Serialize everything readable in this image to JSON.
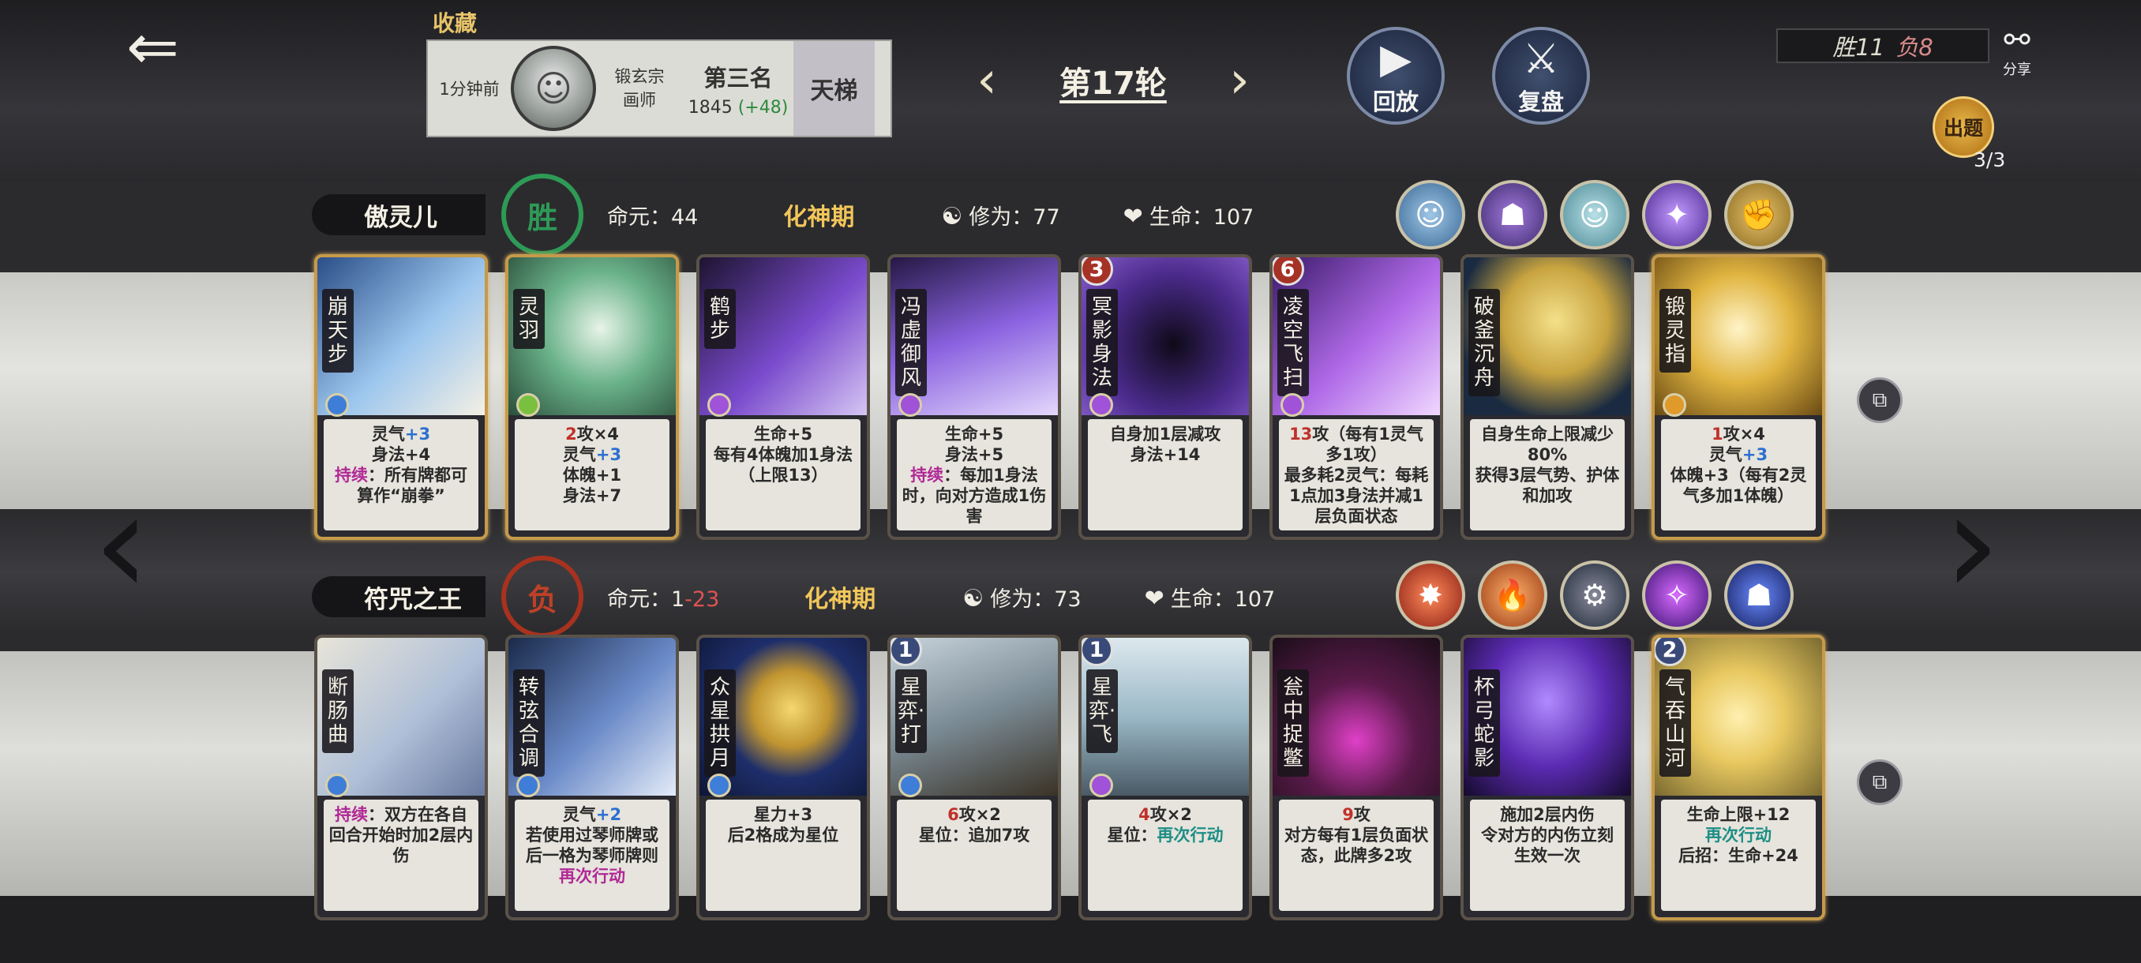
{
  "header": {
    "favorite_label": "收藏",
    "opponent": {
      "time_ago": "1分钟前",
      "sect_line1": "锻玄宗",
      "sect_line2": "画师",
      "rank_name": "第三名",
      "rank_score": "1845",
      "rank_delta": "(+48)",
      "ladder_label": "天梯"
    },
    "round_title": "第17轮",
    "replay_label": "回放",
    "review_label": "复盘",
    "record_win": "胜11",
    "record_lose": "负8",
    "share_label": "分享",
    "quiz_label": "出题",
    "quiz_count": "3/3"
  },
  "player1": {
    "name": "傲灵儿",
    "result": "胜",
    "life_label": "命元：",
    "life_value": "44",
    "realm": "化神期",
    "cult_label": "修为：",
    "cult_value": "77",
    "hp_label": "生命：",
    "hp_value": "107",
    "cards": [
      {
        "name": "崩天步",
        "desc_html": "灵气<span class='blue'>+3</span><br>身法+4<br><span class='kw'>持续</span>：所有牌都可算作“崩拳”"
      },
      {
        "name": "灵羽",
        "desc_html": "<span class='red'>2</span>攻×4<br>灵气<span class='blue'>+3</span><br>体魄+1<br>身法+7"
      },
      {
        "name": "鹤步",
        "desc_html": "生命+5<br>每有4体魄加1身法（上限13）"
      },
      {
        "name": "冯虚御风",
        "desc_html": "生命+5<br>身法+5<br><span class='kw'>持续</span>：每加1身法时，向对方造成1伤害"
      },
      {
        "name": "冥影身法",
        "level": "3",
        "desc_html": "自身加1层减攻<br>身法+14"
      },
      {
        "name": "凌空飞扫",
        "level": "6",
        "desc_html": "<span class='red'>13</span>攻（每有1灵气多1攻）<br>最多耗2灵气：每耗1点加3身法并减1层负面状态"
      },
      {
        "name": "破釜沉舟",
        "desc_html": "自身生命上限减少80%<br>获得3层气势、护体和加攻"
      },
      {
        "name": "锻灵指",
        "desc_html": "<span class='red'>1</span>攻×4<br>灵气<span class='blue'>+3</span><br>体魄+3（每有2灵气多加1体魄）"
      }
    ]
  },
  "player2": {
    "name": "符咒之王",
    "result": "负",
    "life_label": "命元：",
    "life_value": "1",
    "life_delta": "-23",
    "realm": "化神期",
    "cult_label": "修为：",
    "cult_value": "73",
    "hp_label": "生命：",
    "hp_value": "107",
    "cards": [
      {
        "name": "断肠曲",
        "desc_html": "<span class='kw'>持续</span>：双方在各自回合开始时加2层内伤"
      },
      {
        "name": "转弦合调",
        "desc_html": "灵气<span class='blue'>+2</span><br>若使用过琴师牌或后一格为琴师牌则<span class='kw'>再次行动</span>"
      },
      {
        "name": "众星拱月",
        "desc_html": "星力+3<br>后2格成为星位"
      },
      {
        "name": "星弈·打",
        "level": "1",
        "desc_html": "<span class='red'>6</span>攻×2<br>星位：追加7攻"
      },
      {
        "name": "星弈·飞",
        "level": "1",
        "desc_html": "<span class='red'>4</span>攻×2<br>星位：<span class='teal'>再次行动</span>"
      },
      {
        "name": "瓮中捉鳖",
        "desc_html": "<span class='red'>9</span>攻<br>对方每有1层负面状态，此牌多2攻"
      },
      {
        "name": "杯弓蛇影",
        "desc_html": "施加2层内伤<br>令对方的内伤立刻生效一次"
      },
      {
        "name": "气吞山河",
        "level": "2",
        "desc_html": "生命上限+12<br><span class='teal'>再次行动</span><br>后招：生命+24"
      }
    ]
  },
  "colors": {
    "win": "#2e9a56",
    "lose": "#c04026",
    "realm": "#f2c65a",
    "gold_frame": "#c59a4a"
  }
}
